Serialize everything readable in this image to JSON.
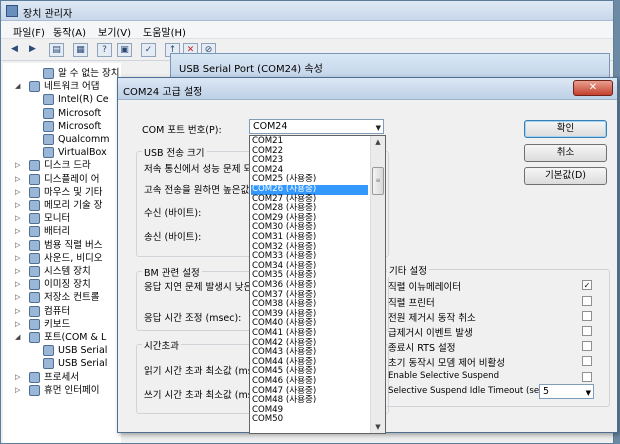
{
  "device_manager": {
    "title": "장치 관리자",
    "menu": [
      "파일(F)",
      "동작(A)",
      "보기(V)",
      "도움말(H)"
    ],
    "tree": [
      {
        "label": "알 수 없는 장치",
        "indent": 3
      },
      {
        "label": "네트워크 어댑",
        "indent": 1,
        "expander": "◢"
      },
      {
        "label": "Intel(R) Ce",
        "indent": 3
      },
      {
        "label": "Microsoft",
        "indent": 3
      },
      {
        "label": "Microsoft",
        "indent": 3
      },
      {
        "label": "Qualcomm",
        "indent": 3
      },
      {
        "label": "VirtualBox",
        "indent": 3
      },
      {
        "label": "디스크 드라",
        "indent": 1,
        "expander": "▷"
      },
      {
        "label": "디스플레이 어",
        "indent": 1,
        "expander": "▷"
      },
      {
        "label": "마우스 및 기타",
        "indent": 1,
        "expander": "▷"
      },
      {
        "label": "메모리 기술 장",
        "indent": 1,
        "expander": "▷"
      },
      {
        "label": "모니터",
        "indent": 1,
        "expander": "▷"
      },
      {
        "label": "배터리",
        "indent": 1,
        "expander": "▷"
      },
      {
        "label": "범용 직렬 버스",
        "indent": 1,
        "expander": "▷"
      },
      {
        "label": "사운드, 비디오",
        "indent": 1,
        "expander": "▷"
      },
      {
        "label": "시스템 장치",
        "indent": 1,
        "expander": "▷"
      },
      {
        "label": "이미징 장치",
        "indent": 1,
        "expander": "▷"
      },
      {
        "label": "저장소 컨트롤",
        "indent": 1,
        "expander": "▷"
      },
      {
        "label": "컴퓨터",
        "indent": 1,
        "expander": "▷"
      },
      {
        "label": "키보드",
        "indent": 1,
        "expander": "▷"
      },
      {
        "label": "포트(COM & L",
        "indent": 1,
        "expander": "◢"
      },
      {
        "label": "USB Serial",
        "indent": 3
      },
      {
        "label": "USB Serial",
        "indent": 3
      },
      {
        "label": "프로세서",
        "indent": 1,
        "expander": "▷"
      },
      {
        "label": "휴먼 인터페이",
        "indent": 1,
        "expander": "▷"
      }
    ]
  },
  "props_window": {
    "title": "USB Serial Port (COM24) 속성"
  },
  "advanced_dialog": {
    "title": "COM24 고급 설정",
    "close": "✕",
    "com_port_label": "COM 포트 번호(P):",
    "com_port_value": "COM24",
    "usb_group": "USB 전송 크기",
    "usb_lines": [
      "저속 통신에서 성능 문제 되",
      "고속 전송을 원하면 높은값"
    ],
    "receive_label": "수신 (바이트):",
    "send_label": "송신 (바이트):",
    "bm_group": "BM 관련 설정",
    "bm_line1": "응답 지연 문제 발생시 낮은",
    "bm_line2": "응답 시간 조정 (msec):",
    "timeout_group": "시간초과",
    "read_timeout": "읽기 시간 초과 최소값 (ms",
    "write_timeout": "쓰기 시간 초과 최소값 (ms",
    "buttons": {
      "ok": "확인",
      "cancel": "취소",
      "default": "기본값(D)"
    },
    "misc_group": "기타 설정",
    "misc_options": [
      {
        "label": "직렬 이뉴메레이터",
        "checked": "✓"
      },
      {
        "label": "직렬 프린터",
        "checked": ""
      },
      {
        "label": "전원 제거시 동작 취소",
        "checked": ""
      },
      {
        "label": "급제거시 이벤트 발생",
        "checked": ""
      },
      {
        "label": "종료시 RTS 설정",
        "checked": ""
      },
      {
        "label": "초기 동작시 모뎀 제어 비활성",
        "checked": ""
      },
      {
        "label": "Enable Selective Suspend",
        "checked": ""
      }
    ],
    "suspend_label": "Selective Suspend Idle Timeout (secs):",
    "suspend_value": "5",
    "com_list": [
      "COM21",
      "COM22",
      "COM23",
      "COM24",
      "COM25 (사용중)",
      "COM26 (사용중)",
      "COM27 (사용중)",
      "COM28 (사용중)",
      "COM29 (사용중)",
      "COM30 (사용중)",
      "COM31 (사용중)",
      "COM32 (사용중)",
      "COM33 (사용중)",
      "COM34 (사용중)",
      "COM35 (사용중)",
      "COM36 (사용중)",
      "COM37 (사용중)",
      "COM38 (사용중)",
      "COM39 (사용중)",
      "COM40 (사용중)",
      "COM41 (사용중)",
      "COM42 (사용중)",
      "COM43 (사용중)",
      "COM44 (사용중)",
      "COM45 (사용중)",
      "COM46 (사용중)",
      "COM47 (사용중)",
      "COM48 (사용중)",
      "COM49",
      "COM50"
    ],
    "selected_index": 5
  }
}
